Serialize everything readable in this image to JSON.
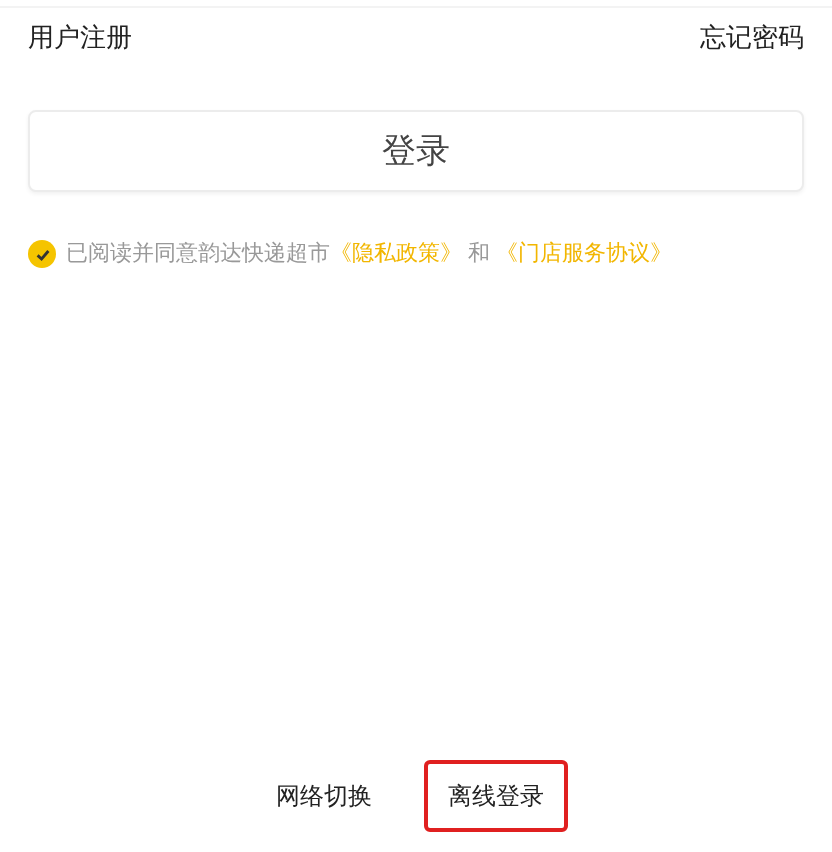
{
  "top_links": [
    {
      "label": "用户注册"
    },
    {
      "label": "忘记密码"
    }
  ],
  "login_button": {
    "label": "登录"
  },
  "agreement": {
    "checked": true,
    "parts": [
      {
        "kind": "text",
        "text": "已阅读并同意韵达快递超市"
      },
      {
        "kind": "link",
        "text": "《隐私政策》"
      },
      {
        "kind": "text",
        "text": " 和 "
      },
      {
        "kind": "link",
        "text": "《门店服务协议》"
      }
    ]
  },
  "bottom_actions": [
    {
      "label": "网络切换",
      "highlighted": false
    },
    {
      "label": "离线登录",
      "highlighted": true
    }
  ]
}
